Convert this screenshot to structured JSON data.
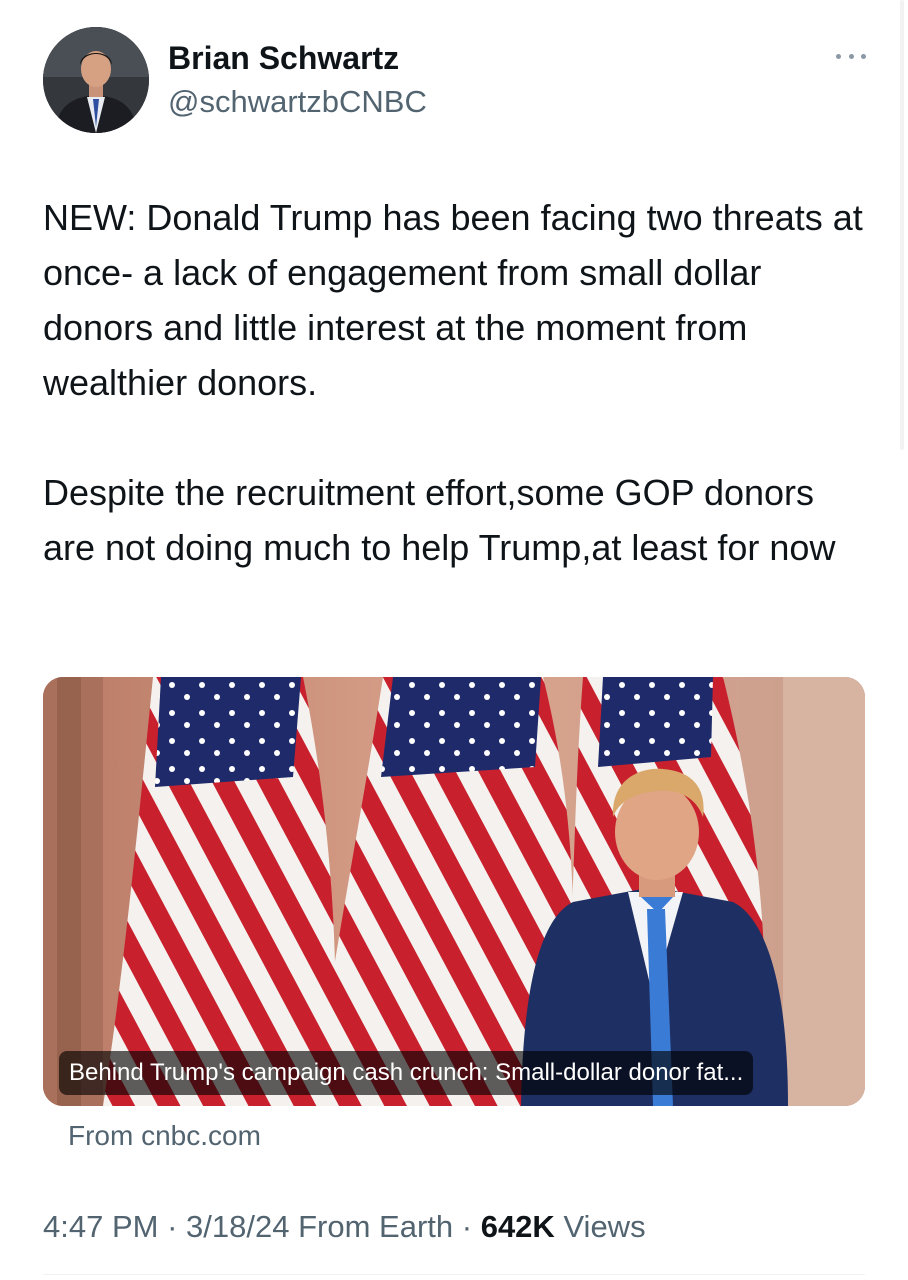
{
  "author": {
    "display_name": "Brian Schwartz",
    "handle": "@schwartzbCNBC",
    "avatar_icon": "profile-photo"
  },
  "tweet": {
    "paragraph_1": "NEW: Donald Trump has been facing two threats at once- a lack of engagement from small dollar donors and little interest at the moment from wealthier donors.",
    "paragraph_2": "Despite the recruitment effort,some GOP donors are not doing much to help Trump,at least for now"
  },
  "card": {
    "caption": "Behind Trump's campaign cash crunch: Small-dollar donor fat...",
    "source": "From cnbc.com"
  },
  "meta": {
    "time": "4:47 PM",
    "date": "3/18/24",
    "client": "From Earth",
    "views_count": "642K",
    "views_label": "Views",
    "separator": "·"
  },
  "colors": {
    "text_primary": "#0f1419",
    "text_secondary": "#536471"
  }
}
